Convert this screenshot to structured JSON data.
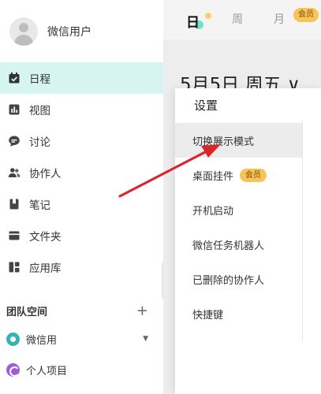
{
  "user": {
    "name": "微信用户"
  },
  "sidebar": {
    "items": [
      {
        "label": "日程",
        "icon": "calendar-check-icon",
        "active": true
      },
      {
        "label": "视图",
        "icon": "bar-chart-icon",
        "active": false
      },
      {
        "label": "讨论",
        "icon": "chat-bubble-icon",
        "active": false
      },
      {
        "label": "协作人",
        "icon": "people-icon",
        "active": false
      },
      {
        "label": "笔记",
        "icon": "bookmark-icon",
        "active": false
      },
      {
        "label": "文件夹",
        "icon": "folder-icon",
        "active": false
      },
      {
        "label": "应用库",
        "icon": "app-grid-icon",
        "active": false
      }
    ],
    "team_section": {
      "title": "团队空间",
      "items": [
        {
          "label": "微信用",
          "icon": "team-circle-icon"
        },
        {
          "label": "个人项目",
          "icon": "project-circle-icon"
        }
      ]
    }
  },
  "topbar": {
    "tabs": [
      "日",
      "周",
      "月"
    ],
    "vip_badge": "会员"
  },
  "main": {
    "date_title": "5月5日 周五 ∨"
  },
  "settings": {
    "title": "设置",
    "items": [
      {
        "label": "切换展示模式",
        "badge": ""
      },
      {
        "label": "桌面挂件",
        "badge": "会员"
      },
      {
        "label": "开机启动",
        "badge": ""
      },
      {
        "label": "微信任务机器人",
        "badge": ""
      },
      {
        "label": "已删除的协作人",
        "badge": ""
      },
      {
        "label": "快捷键",
        "badge": ""
      }
    ]
  },
  "colors": {
    "active_nav_bg": "#d6f5f0",
    "accent_teal": "#34b3b3",
    "vip_yellow": "#f8c45a",
    "annotation_arrow": "#d9262b"
  }
}
